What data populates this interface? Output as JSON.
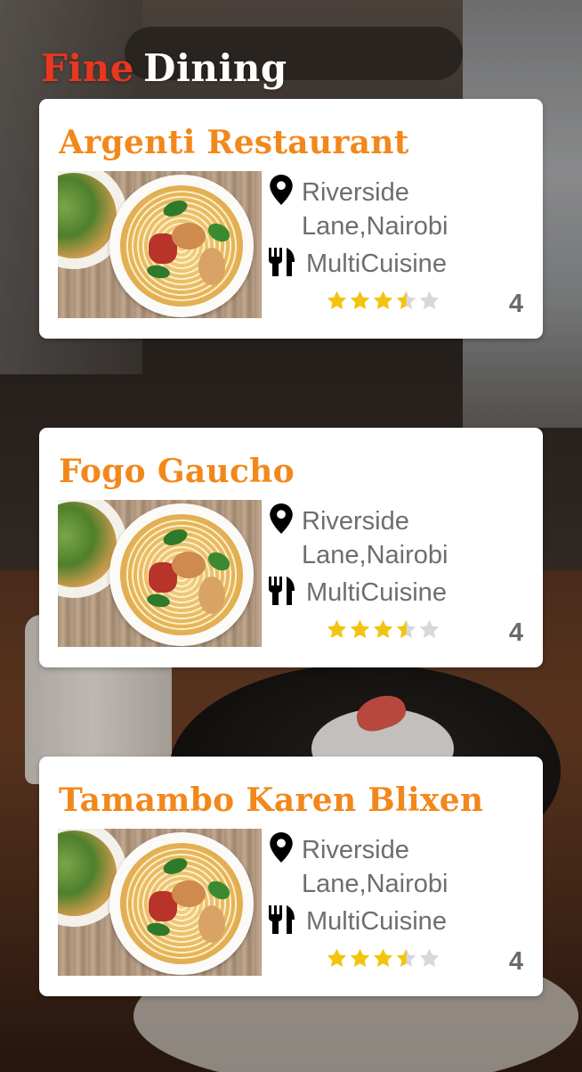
{
  "header": {
    "word1": "Fine",
    "word2": "Dining"
  },
  "colors": {
    "accent_red": "#e8371e",
    "accent_orange": "#f2881b",
    "star_gold": "#f2c40f",
    "star_empty": "#d8d8d8",
    "text_gray": "#6e6e6e"
  },
  "restaurants": [
    {
      "name": "Argenti Restaurant",
      "address": "Riverside Lane,Nairobi",
      "cuisine": "MultiCuisine",
      "stars": 3.5,
      "rating": "4",
      "icon_location": "map-pin-icon",
      "icon_cuisine": "fork-knife-icon"
    },
    {
      "name": "Fogo Gaucho",
      "address": "Riverside Lane,Nairobi",
      "cuisine": "MultiCuisine",
      "stars": 3.5,
      "rating": "4",
      "icon_location": "map-pin-icon",
      "icon_cuisine": "fork-knife-icon"
    },
    {
      "name": "Tamambo Karen Blixen",
      "address": "Riverside Lane,Nairobi",
      "cuisine": "MultiCuisine",
      "stars": 3.5,
      "rating": "4",
      "icon_location": "map-pin-icon",
      "icon_cuisine": "fork-knife-icon"
    }
  ]
}
